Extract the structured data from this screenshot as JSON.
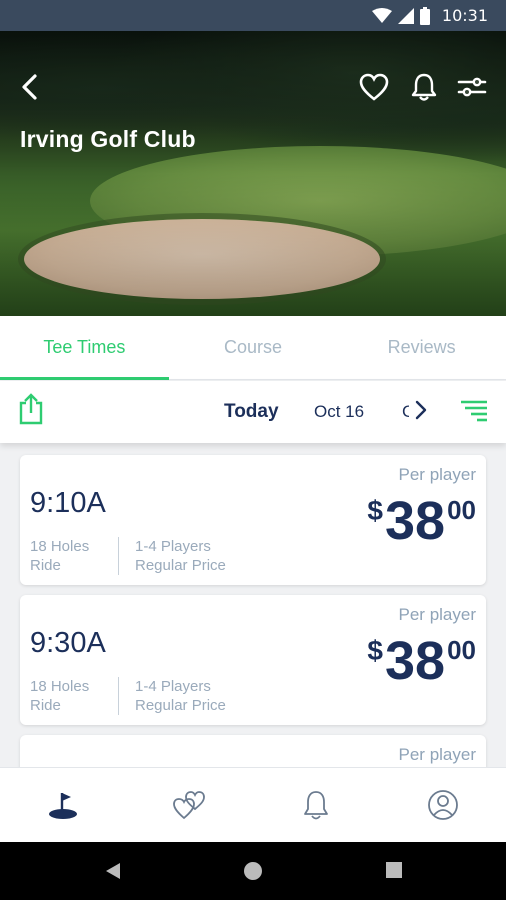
{
  "status_bar": {
    "time": "10:31",
    "icons": [
      "wifi-icon",
      "signal-icon",
      "battery-icon"
    ]
  },
  "hero": {
    "title": "Irving Golf Club",
    "icons": [
      "back-arrow-icon",
      "heart-icon",
      "bell-icon",
      "sliders-icon"
    ]
  },
  "tabs": [
    {
      "label": "Tee Times",
      "active": true
    },
    {
      "label": "Course",
      "active": false
    },
    {
      "label": "Reviews",
      "active": false
    }
  ],
  "date_bar": {
    "today": "Today",
    "next_date": "Oct 16",
    "cut_date": "C"
  },
  "tee_times": [
    {
      "time": "9:10A",
      "per_label": "Per player",
      "currency": "$",
      "price_whole": "38",
      "price_cents": "00",
      "holes": "18 Holes",
      "cart": "Ride",
      "players": "1-4 Players",
      "rate": "Regular Price"
    },
    {
      "time": "9:30A",
      "per_label": "Per player",
      "currency": "$",
      "price_whole": "38",
      "price_cents": "00",
      "holes": "18 Holes",
      "cart": "Ride",
      "players": "1-4 Players",
      "rate": "Regular Price"
    },
    {
      "per_label": "Per player"
    }
  ],
  "bottom_nav": [
    "golf-flag-icon",
    "hearts-icon",
    "bell-icon",
    "profile-icon"
  ],
  "colors": {
    "accent": "#2ecc71",
    "navy": "#1c2f5a",
    "muted": "#a9b9c6",
    "status_bar": "#3a4a5e"
  }
}
